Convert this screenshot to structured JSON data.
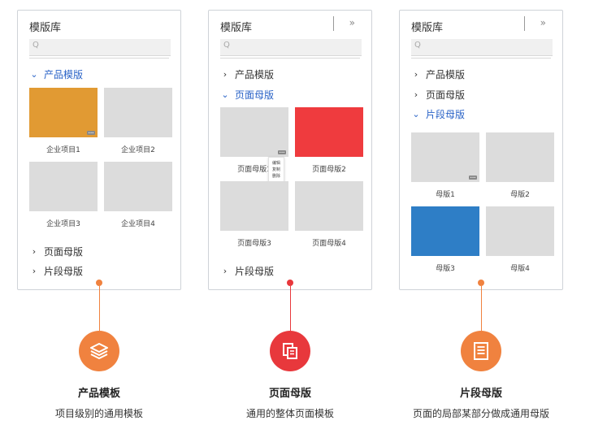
{
  "colors": {
    "orange": "#f0823f",
    "red": "#e8383c",
    "blue": "#2a63c7",
    "thumb_orange": "#e19a33",
    "thumb_red": "#ef3b3e",
    "thumb_blue": "#2e7ec6"
  },
  "panels": [
    {
      "title": "模版库",
      "search_placeholder": "Q",
      "sections": [
        "产品模版",
        "页面母版",
        "片段母版"
      ],
      "thumb_captions": [
        "企业项目1",
        "企业项目2",
        "企业项目3",
        "企业项目4"
      ]
    },
    {
      "title": "模版库",
      "collapse_icon": "»",
      "search_placeholder": "Q",
      "sections": [
        "产品模版",
        "页面母版",
        "片段母版"
      ],
      "thumb_captions": [
        "页面母版1",
        "页面母版2",
        "页面母版3",
        "页面母版4"
      ],
      "context_menu": [
        "编辑",
        "复制",
        "删除"
      ]
    },
    {
      "title": "模版库",
      "collapse_icon": "»",
      "search_placeholder": "Q",
      "sections": [
        "产品模版",
        "页面母版",
        "片段母版"
      ],
      "thumb_captions": [
        "母版1",
        "母版2",
        "母版3",
        "母版4"
      ]
    }
  ],
  "features": [
    {
      "title": "产品模板",
      "desc": "项目级别的通用模板",
      "icon": "layers-icon"
    },
    {
      "title": "页面母版",
      "desc": "通用的整体页面模板",
      "icon": "pages-icon"
    },
    {
      "title": "片段母版",
      "desc": "页面的局部某部分做成通用母版",
      "icon": "document-icon"
    }
  ]
}
